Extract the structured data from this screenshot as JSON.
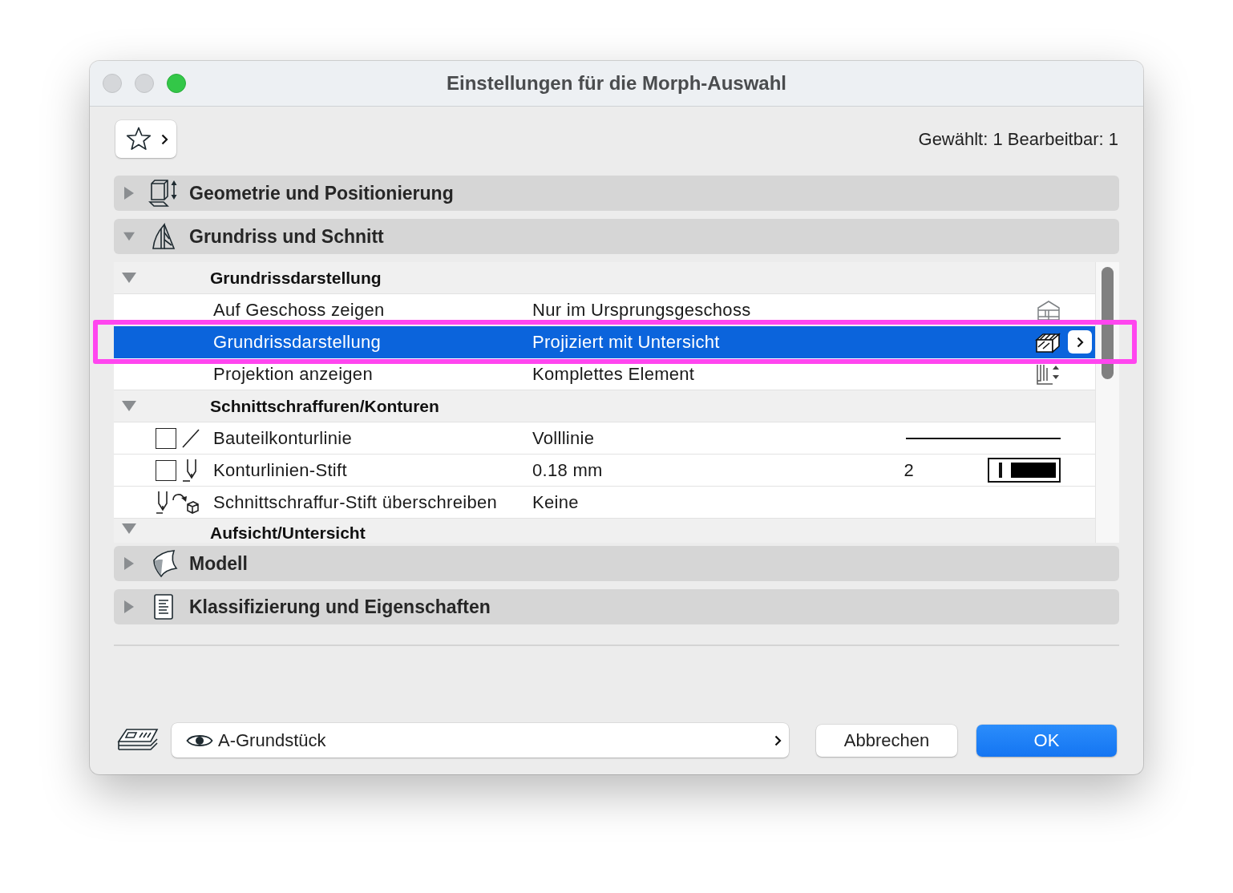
{
  "window": {
    "title": "Einstellungen für die Morph-Auswahl",
    "controls": [
      {
        "kind": "close",
        "disabled": true
      },
      {
        "kind": "minimize",
        "disabled": true
      },
      {
        "kind": "zoom",
        "disabled": false
      }
    ]
  },
  "selection_info": "Gewählt: 1 Bearbeitbar: 1",
  "panels": [
    {
      "title": "Geometrie und Positionierung",
      "expanded": false
    },
    {
      "title": "Grundriss und Schnitt",
      "expanded": true,
      "groups": [
        {
          "title": "Grundrissdarstellung",
          "expanded": true,
          "rows": [
            {
              "kind": "storey",
              "name": "Auf Geschoss zeigen",
              "value": "Nur im Ursprungsgeschoss",
              "selected": false,
              "highlighted": false
            },
            {
              "kind": "display",
              "name": "Grundrissdarstellung",
              "value": "Projiziert mit Untersicht",
              "selected": true,
              "highlighted": true
            },
            {
              "kind": "projection",
              "name": "Projektion anzeigen",
              "value": "Komplettes Element",
              "selected": false,
              "highlighted": false
            }
          ]
        },
        {
          "title": "Schnittschraffuren/Konturen",
          "expanded": true,
          "rows": [
            {
              "kind": "line_type",
              "name": "Bauteilkonturlinie",
              "value": "Volllinie",
              "checkbox": {
                "checked": false
              },
              "selected": false,
              "highlighted": false
            },
            {
              "kind": "pen",
              "name": "Konturlinien-Stift",
              "value": "0.18 mm",
              "pen_number": "2",
              "checkbox": {
                "checked": false
              },
              "selected": false,
              "highlighted": false
            },
            {
              "kind": "pen_override",
              "name": "Schnittschraffur-Stift überschreiben",
              "value": "Keine",
              "selected": false,
              "highlighted": false
            }
          ]
        },
        {
          "title": "Aufsicht/Untersicht",
          "expanded": true
        }
      ]
    },
    {
      "title": "Modell",
      "expanded": false
    },
    {
      "title": "Klassifizierung und Eigenschaften",
      "expanded": false
    }
  ],
  "layer": {
    "value": "A-Grundstück"
  },
  "buttons": [
    {
      "label": "Abbrechen",
      "default": false
    },
    {
      "label": "OK",
      "default": true
    }
  ]
}
